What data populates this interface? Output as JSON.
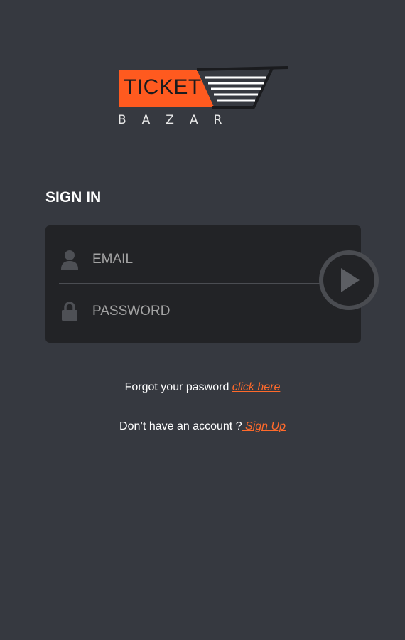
{
  "logo": {
    "word": "TICKET",
    "subtitle": "BAZAR",
    "accent_color": "#ff5a1f"
  },
  "sign_in": {
    "heading": "SIGN IN"
  },
  "form": {
    "email_placeholder": "EMAIL",
    "password_placeholder": "PASSWORD",
    "email_icon": "user-icon",
    "password_icon": "lock-icon",
    "submit_icon": "play-arrow-icon"
  },
  "forgot": {
    "text": "Forgot your pasword ",
    "link": "click here"
  },
  "signup": {
    "text": "Don’t have an account ?",
    "link": " Sign Up"
  },
  "colors": {
    "background": "#363940",
    "card": "#222326",
    "link": "#ff6a2b"
  }
}
